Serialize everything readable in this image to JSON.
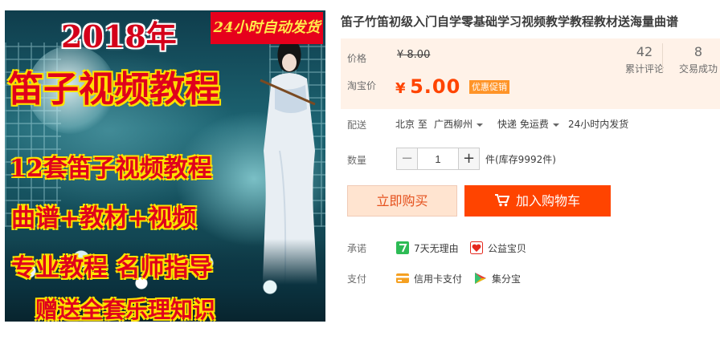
{
  "image": {
    "year_text": "2018年",
    "badge_text": "24小时自动发货",
    "main_text": "笛子视频教程",
    "line1": "12套笛子视频教程",
    "line2": "曲谱+教材+视频",
    "line3": "专业教程 名师指导",
    "line4": "赠送全套乐理知识"
  },
  "product": {
    "title": "笛子竹笛初级入门自学零基础学习视频教学教程教材送海量曲谱"
  },
  "price": {
    "label": "价格",
    "original": "¥ 8.00",
    "sale_label": "淘宝价",
    "currency": "¥",
    "sale_value": "5.00",
    "promo_tag": "优惠促销",
    "accent_color": "#ff4400"
  },
  "stats": {
    "reviews_count": "42",
    "reviews_label": "累计评论",
    "sold_count": "8",
    "sold_label": "交易成功"
  },
  "shipping": {
    "label": "配送",
    "from": "北京 至",
    "to": "广西柳州",
    "method": "快递 免运费",
    "dispatch": "24小时内发货"
  },
  "quantity": {
    "label": "数量",
    "value": "1",
    "minus": "−",
    "plus": "+",
    "stock": "件(库存9992件)"
  },
  "actions": {
    "buy_now": "立即购买",
    "add_to_cart": "加入购物车"
  },
  "promise": {
    "label": "承诺",
    "items": [
      "7天无理由",
      "公益宝贝"
    ]
  },
  "payment": {
    "label": "支付",
    "items": [
      "信用卡支付",
      "集分宝"
    ]
  },
  "icons": {
    "cart": "shopping-cart-icon",
    "seven_day": "seven-day-return-icon",
    "charity": "charity-heart-icon",
    "credit_card": "credit-card-icon",
    "jifenbao": "jifenbao-icon"
  }
}
